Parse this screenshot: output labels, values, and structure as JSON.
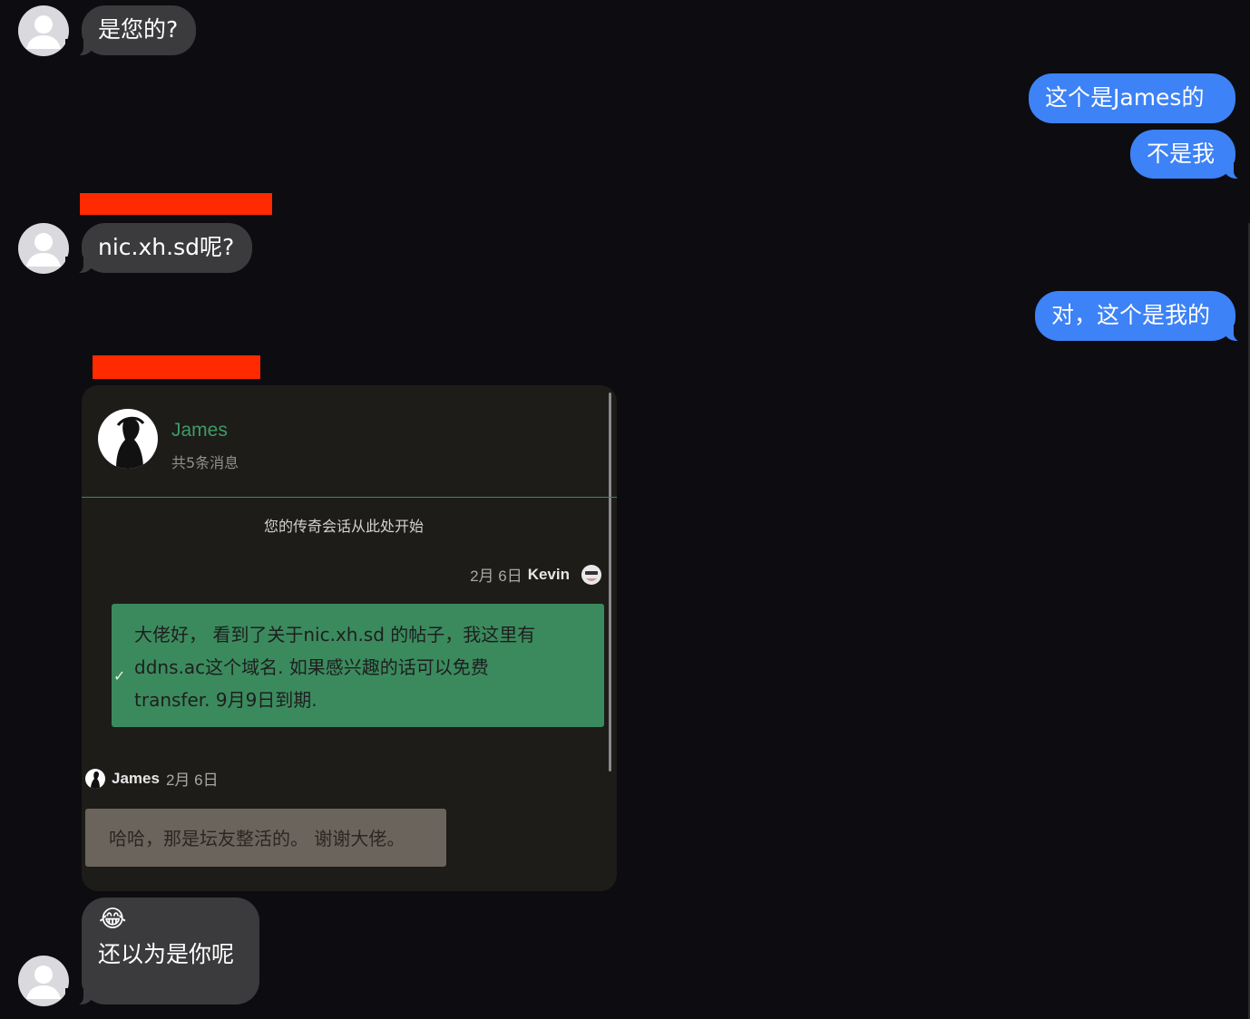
{
  "messages": {
    "m1": "是您的?",
    "m2": "这个是James的",
    "m3": "不是我",
    "m4": "nic.xh.sd呢?",
    "m5": "对，这个是我的",
    "m6_emoji": "😂",
    "m6_text": "还以为是你呢"
  },
  "card": {
    "name": "James",
    "subtitle": "共5条消息",
    "start_text": "您的传奇会话从此处开始",
    "msg1": {
      "date": "2月 6日",
      "sender": "Kevin",
      "lines": [
        "大佬好， 看到了关于nic.xh.sd 的帖子，我这里有",
        "ddns.ac这个域名. 如果感兴趣的话可以免费",
        "transfer. 9月9日到期."
      ],
      "status_icon": "checkmark-icon"
    },
    "msg2": {
      "sender": "James",
      "date": "2月 6日",
      "text": "哈哈，那是坛友整活的。 谢谢大佬。"
    }
  },
  "colors": {
    "background": "#0d0c10",
    "incoming": "#3b3b3d",
    "outgoing": "#3d82f6",
    "redaction": "#ff2a00",
    "card_accent": "#3f9a67"
  }
}
